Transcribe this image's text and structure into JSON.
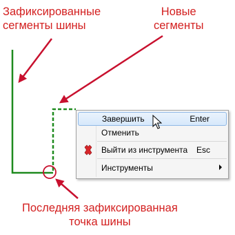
{
  "callouts": {
    "fixed_segments": [
      "Зафиксированные",
      "сегменты шины"
    ],
    "new_segments": [
      "Новые",
      "сегменты"
    ],
    "last_point": [
      "Последняя зафиксированная",
      "точка шины"
    ]
  },
  "context_menu": {
    "items": [
      {
        "label": "Завершить",
        "shortcut": "Enter",
        "icon": null,
        "highlighted": true
      },
      {
        "label": "Отменить",
        "shortcut": "",
        "icon": null
      },
      {
        "label": "Выйти из инструмента",
        "shortcut": "Esc",
        "icon": "red-x-icon"
      },
      {
        "label": "Инструменты",
        "shortcut": "",
        "icon": null,
        "submenu": true
      }
    ]
  },
  "colors": {
    "callout_text": "#d32020",
    "fixed_segment": "#1e8a1e",
    "new_segment": "#1e8a1e",
    "highlight": "#d6e8fb"
  }
}
